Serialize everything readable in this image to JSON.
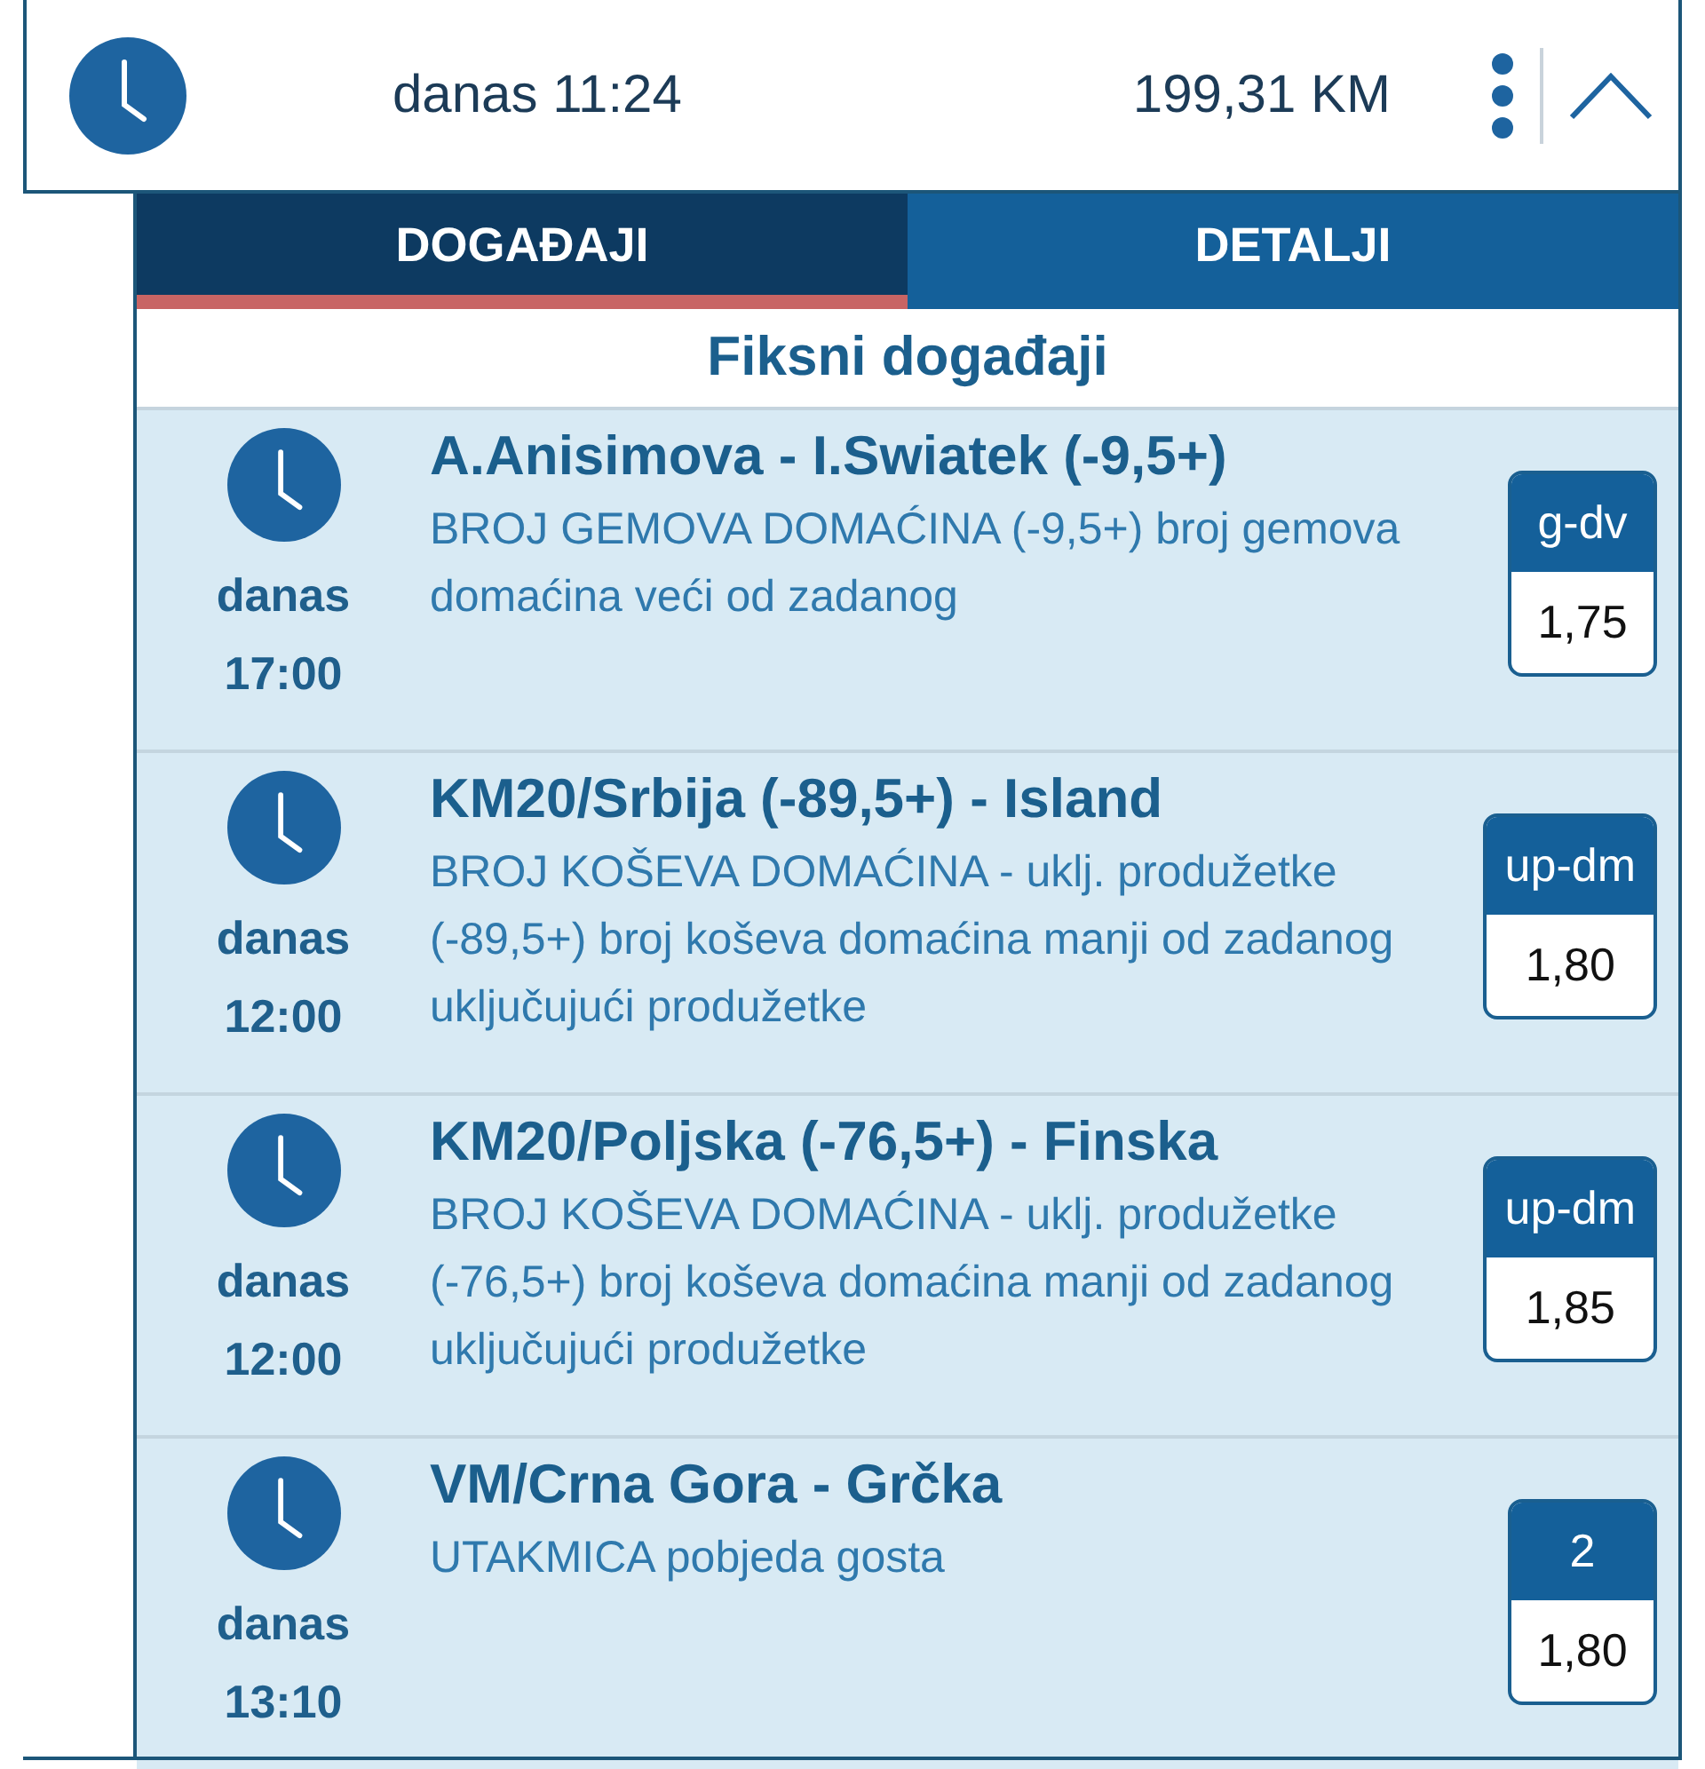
{
  "header": {
    "time": "danas 11:24",
    "amount": "199,31 KM",
    "expanded": true
  },
  "tabs": [
    {
      "label": "DOGAĐAJI",
      "selected": true
    },
    {
      "label": "DETALJI",
      "selected": false
    }
  ],
  "section_title": "Fiksni događaji",
  "events": [
    {
      "day": "danas",
      "time": "17:00",
      "title": "A.Anisimova - I.Swiatek (-9,5+)",
      "description": "BROJ GEMOVA DOMAĆINA (-9,5+) broj gemova domaćina veći od zadanog",
      "tip": "g-dv",
      "odds": "1,75"
    },
    {
      "day": "danas",
      "time": "12:00",
      "title": "KM20/Srbija (-89,5+) - Island",
      "description": "BROJ KOŠEVA DOMAĆINA - uklj. produžetke (-89,5+) broj koševa domaćina manji od zadanog uključujući produžetke",
      "tip": "up-dm",
      "odds": "1,80"
    },
    {
      "day": "danas",
      "time": "12:00",
      "title": "KM20/Poljska (-76,5+) - Finska",
      "description": "BROJ KOŠEVA DOMAĆINA - uklj. produžetke (-76,5+) broj koševa domaćina manji od zadanog uključujući produžetke",
      "tip": "up-dm",
      "odds": "1,85"
    },
    {
      "day": "danas",
      "time": "13:10",
      "title": "VM/Crna Gora - Grčka",
      "description": "UTAKMICA pobjeda gosta",
      "tip": "2",
      "odds": "1,80"
    }
  ]
}
